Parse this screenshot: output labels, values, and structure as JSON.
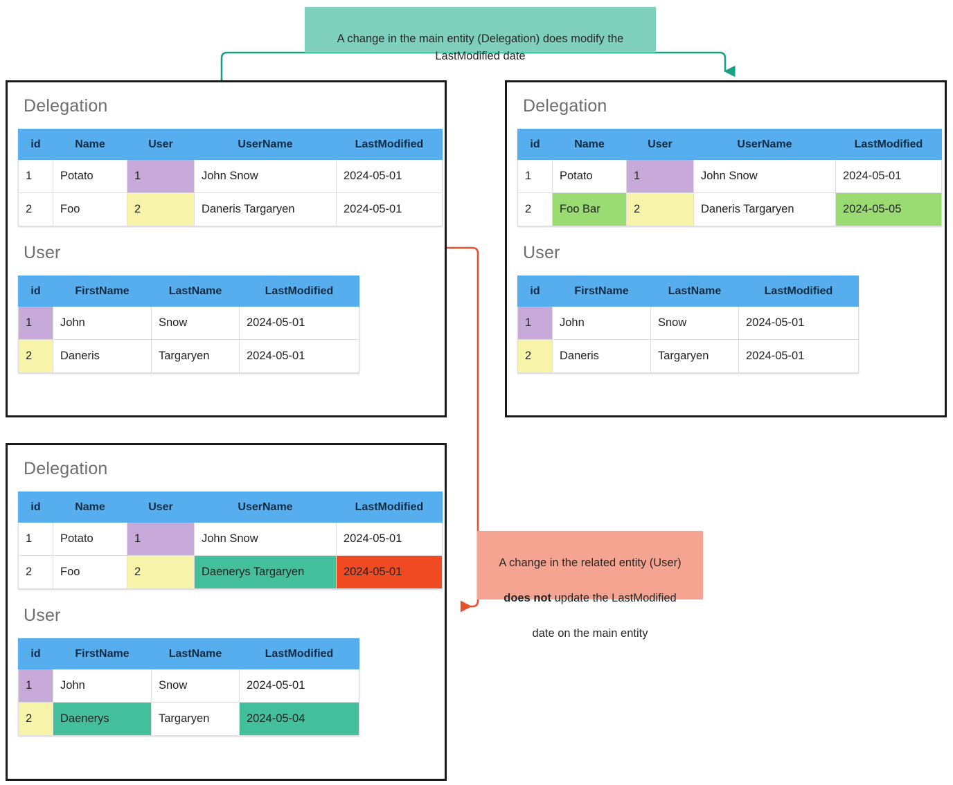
{
  "notes": {
    "green": {
      "text": "A change in the main entity (Delegation) does modify the LastModified date",
      "background": "#7ecfbb"
    },
    "orange": {
      "line1": "A change in the related entity (User)",
      "emphasis": "does not",
      "line2_rest": " update the LastModified",
      "line3": "date on the main entity",
      "background": "#f5a491"
    }
  },
  "colors": {
    "table_header": "#56aeee",
    "highlight_purple": "#c8aada",
    "highlight_yellow": "#f7f3a8",
    "highlight_green": "#9adb72",
    "highlight_teal": "#44bf9b",
    "highlight_red": "#f04a23",
    "arrow_green": "#16a085",
    "arrow_orange": "#e8502c",
    "panel_border": "#1a1a1a",
    "entity_title": "#6d6d6d"
  },
  "panels": {
    "before": {
      "delegation": {
        "title": "Delegation",
        "headers": [
          "id",
          "Name",
          "User",
          "UserName",
          "LastModified"
        ],
        "rows": [
          {
            "id": "1",
            "name": "Potato",
            "user": "1",
            "username": "John Snow",
            "lastmodified": "2024-05-01"
          },
          {
            "id": "2",
            "name": "Foo",
            "user": "2",
            "username": "Daneris Targaryen",
            "lastmodified": "2024-05-01"
          }
        ]
      },
      "user": {
        "title": "User",
        "headers": [
          "id",
          "FirstName",
          "LastName",
          "LastModified"
        ],
        "rows": [
          {
            "id": "1",
            "firstname": "John",
            "lastname": "Snow",
            "lastmodified": "2024-05-01"
          },
          {
            "id": "2",
            "firstname": "Daneris",
            "lastname": "Targaryen",
            "lastmodified": "2024-05-01"
          }
        ]
      }
    },
    "after": {
      "delegation": {
        "title": "Delegation",
        "headers": [
          "id",
          "Name",
          "User",
          "UserName",
          "LastModified"
        ],
        "rows": [
          {
            "id": "1",
            "name": "Potato",
            "user": "1",
            "username": "John Snow",
            "lastmodified": "2024-05-01"
          },
          {
            "id": "2",
            "name": "Foo Bar",
            "user": "2",
            "username": "Daneris Targaryen",
            "lastmodified": "2024-05-05"
          }
        ]
      },
      "user": {
        "title": "User",
        "headers": [
          "id",
          "FirstName",
          "LastName",
          "LastModified"
        ],
        "rows": [
          {
            "id": "1",
            "firstname": "John",
            "lastname": "Snow",
            "lastmodified": "2024-05-01"
          },
          {
            "id": "2",
            "firstname": "Daneris",
            "lastname": "Targaryen",
            "lastmodified": "2024-05-01"
          }
        ]
      }
    },
    "related": {
      "delegation": {
        "title": "Delegation",
        "headers": [
          "id",
          "Name",
          "User",
          "UserName",
          "LastModified"
        ],
        "rows": [
          {
            "id": "1",
            "name": "Potato",
            "user": "1",
            "username": "John Snow",
            "lastmodified": "2024-05-01"
          },
          {
            "id": "2",
            "name": "Foo",
            "user": "2",
            "username": "Daenerys Targaryen",
            "lastmodified": "2024-05-01"
          }
        ]
      },
      "user": {
        "title": "User",
        "headers": [
          "id",
          "FirstName",
          "LastName",
          "LastModified"
        ],
        "rows": [
          {
            "id": "1",
            "firstname": "John",
            "lastname": "Snow",
            "lastmodified": "2024-05-01"
          },
          {
            "id": "2",
            "firstname": "Daenerys",
            "lastname": "Targaryen",
            "lastmodified": "2024-05-04"
          }
        ]
      }
    }
  }
}
